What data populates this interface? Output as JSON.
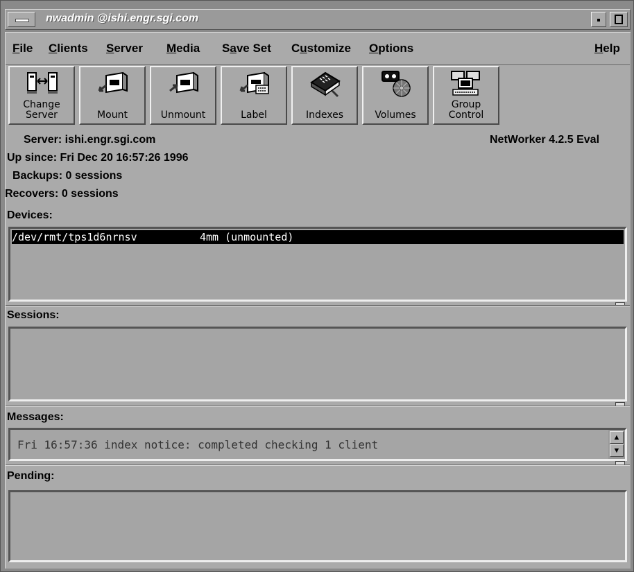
{
  "window": {
    "title": "nwadmin @ishi.engr.sgi.com"
  },
  "menubar": {
    "items": [
      {
        "label": "File",
        "mnemonic": "F"
      },
      {
        "label": "Clients",
        "mnemonic": "C"
      },
      {
        "label": "Server",
        "mnemonic": "S"
      },
      {
        "label": "Media",
        "mnemonic": "M"
      },
      {
        "label": "Save Set",
        "mnemonic": "a"
      },
      {
        "label": "Customize",
        "mnemonic": "u"
      },
      {
        "label": "Options",
        "mnemonic": "O"
      }
    ],
    "help": {
      "label": "Help",
      "mnemonic": "H"
    }
  },
  "toolbar": {
    "buttons": [
      {
        "line1": "Change",
        "line2": "Server",
        "icon": "change-server-icon"
      },
      {
        "line1": "",
        "line2": "Mount",
        "icon": "mount-icon"
      },
      {
        "line1": "",
        "line2": "Unmount",
        "icon": "unmount-icon"
      },
      {
        "line1": "",
        "line2": "Label",
        "icon": "label-icon"
      },
      {
        "line1": "",
        "line2": "Indexes",
        "icon": "indexes-icon"
      },
      {
        "line1": "",
        "line2": "Volumes",
        "icon": "volumes-icon"
      },
      {
        "line1": "Group",
        "line2": "Control",
        "icon": "group-control-icon"
      }
    ]
  },
  "server_info": {
    "server_label": "Server:",
    "server_value": "ishi.engr.sgi.com",
    "up_since_label": "Up since:",
    "up_since_value": "Fri Dec 20 16:57:26 1996",
    "backups_label": "Backups:",
    "backups_value": "0 sessions",
    "recovers_label": "Recovers:",
    "recovers_value": "0 sessions",
    "version": "NetWorker 4.2.5 Eval"
  },
  "devices": {
    "label": "Devices:",
    "rows": [
      {
        "path": "/dev/rmt/tps1d6nrnsv",
        "status": "4mm (unmounted)"
      }
    ]
  },
  "sessions": {
    "label": "Sessions:"
  },
  "messages": {
    "label": "Messages:",
    "text": "Fri 16:57:36 index notice: completed checking 1 client"
  },
  "pending": {
    "label": "Pending:"
  },
  "colors": {
    "background": "#aaaaaa",
    "selection": "#000000"
  }
}
